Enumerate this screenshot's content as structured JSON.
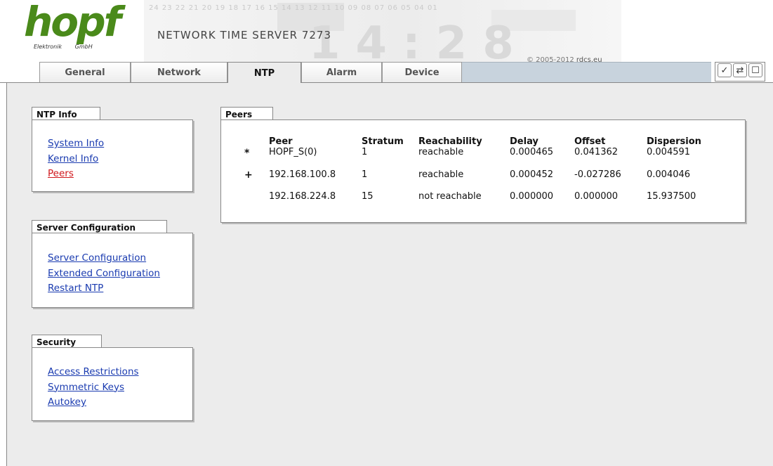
{
  "header": {
    "logo_word": "hopf",
    "logo_sub": "Elektronik GmbH",
    "bg_digits": "24 23 22 21 20 19 18 17 16 15 14 13 12 11 10 09 08 07 06 05 04 01",
    "bg_clock": "14:28",
    "product_title": "NETWORK TIME SERVER 7273",
    "copyright_prefix": "© 2005-2012",
    "copyright_link": "rdcs.eu"
  },
  "tabs": [
    {
      "label": "General"
    },
    {
      "label": "Network"
    },
    {
      "label": "NTP"
    },
    {
      "label": "Alarm"
    },
    {
      "label": "Device"
    }
  ],
  "active_tab": "NTP",
  "toolbar": [
    {
      "icon": "check-icon",
      "glyph": "✓"
    },
    {
      "icon": "refresh-icon",
      "glyph": "⇄"
    },
    {
      "icon": "save-icon",
      "glyph": "☐"
    }
  ],
  "sidebar": {
    "ntp_info": {
      "title": "NTP Info",
      "links": [
        {
          "label": "System Info"
        },
        {
          "label": "Kernel Info"
        },
        {
          "label": "Peers",
          "current": true
        }
      ]
    },
    "server_configuration": {
      "title": "Server Configuration",
      "links": [
        {
          "label": "Server Configuration"
        },
        {
          "label": "Extended Configuration"
        },
        {
          "label": "Restart NTP"
        }
      ]
    },
    "security": {
      "title": "Security",
      "links": [
        {
          "label": "Access Restrictions"
        },
        {
          "label": "Symmetric Keys"
        },
        {
          "label": "Autokey"
        }
      ]
    }
  },
  "peers": {
    "title": "Peers",
    "columns": [
      "Peer",
      "Stratum",
      "Reachability",
      "Delay",
      "Offset",
      "Dispersion"
    ],
    "rows": [
      {
        "flag": "*",
        "peer": "HOPF_S(0)",
        "stratum": "1",
        "reachability": "reachable",
        "delay": "0.000465",
        "offset": "0.041362",
        "dispersion": "0.004591"
      },
      {
        "flag": "+",
        "peer": "192.168.100.8",
        "stratum": "1",
        "reachability": "reachable",
        "delay": "0.000452",
        "offset": "-0.027286",
        "dispersion": "0.004046"
      },
      {
        "flag": "",
        "peer": "192.168.224.8",
        "stratum": "15",
        "reachability": "not reachable",
        "delay": "0.000000",
        "offset": "0.000000",
        "dispersion": "15.937500"
      }
    ]
  },
  "colors": {
    "logo_green": "#4a8a1a",
    "link_blue": "#1a3bb0",
    "link_active_red": "#d0161b",
    "content_bg": "#ececec",
    "tabbar_fill": "#c8d3dd"
  }
}
